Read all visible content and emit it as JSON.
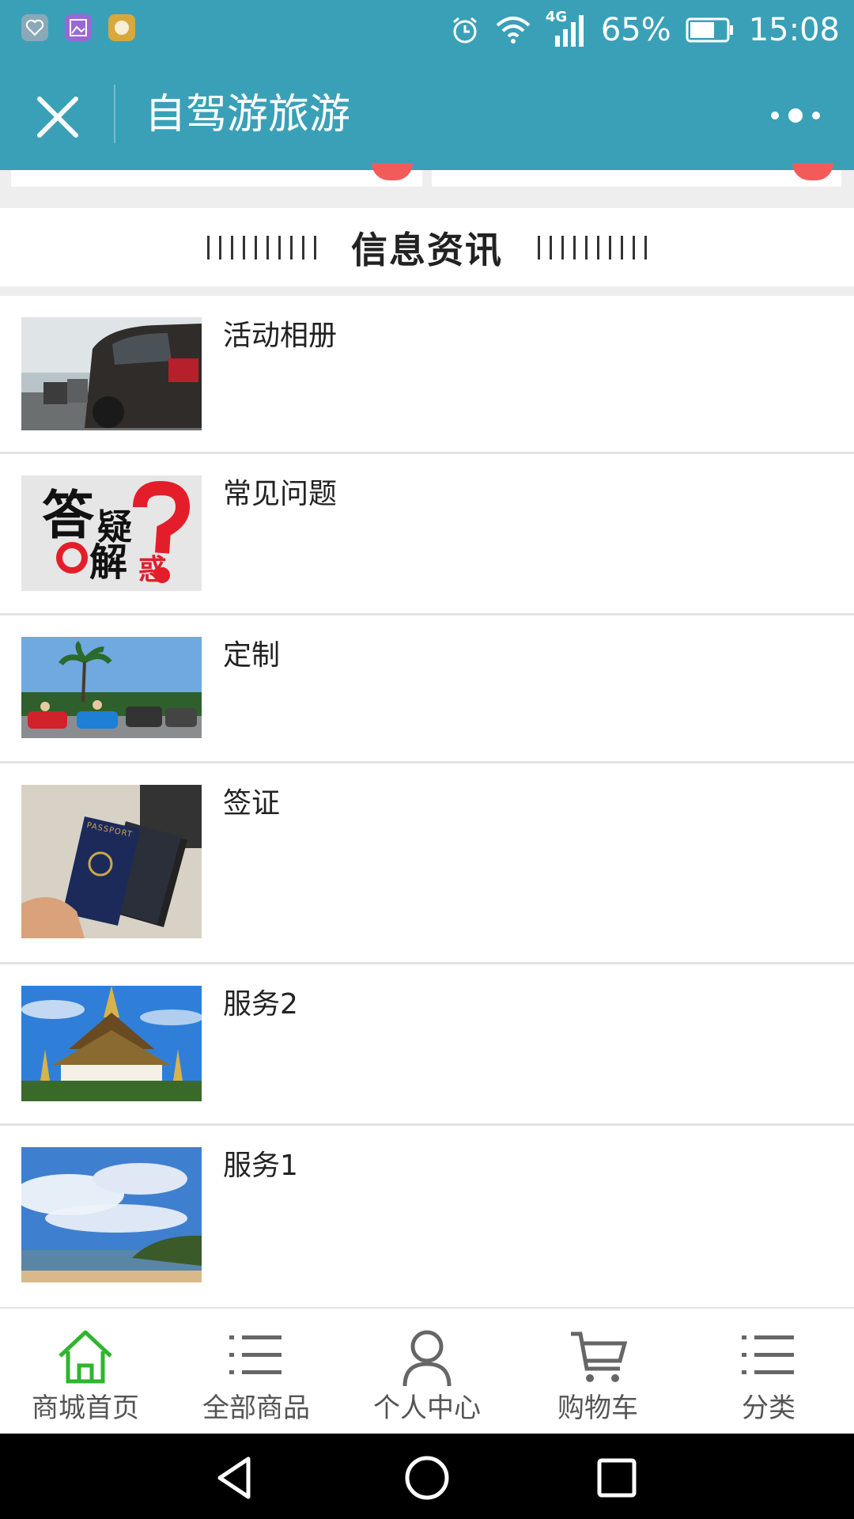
{
  "status_bar": {
    "network": "4G",
    "battery_percent": "65%",
    "time": "15:08",
    "icons": [
      "heart-app-icon",
      "gallery-app-icon",
      "hand-app-icon",
      "alarm-icon",
      "wifi-icon",
      "signal-icon",
      "battery-icon"
    ]
  },
  "title_bar": {
    "title": "自驾游旅游",
    "icons": [
      "close-icon",
      "more-icon"
    ]
  },
  "section": {
    "title": "信息资讯"
  },
  "list": {
    "items": [
      {
        "title": "活动相册"
      },
      {
        "title": "常见问题",
        "thumb_text": [
          "答",
          "疑",
          "解",
          "惑"
        ]
      },
      {
        "title": "定制"
      },
      {
        "title": "签证",
        "thumb_text": "PASSPORT"
      },
      {
        "title": "服务2"
      },
      {
        "title": "服务1"
      }
    ]
  },
  "bottom_nav": {
    "items": [
      {
        "label": "商城首页",
        "icon": "home-icon",
        "active": true
      },
      {
        "label": "全部商品",
        "icon": "list-icon"
      },
      {
        "label": "个人中心",
        "icon": "person-icon"
      },
      {
        "label": "购物车",
        "icon": "cart-icon"
      },
      {
        "label": "分类",
        "icon": "list-icon"
      }
    ],
    "active_color": "#2fb52f"
  },
  "colors": {
    "header": "#3aa0b8",
    "accent_red": "#f35b5b"
  }
}
